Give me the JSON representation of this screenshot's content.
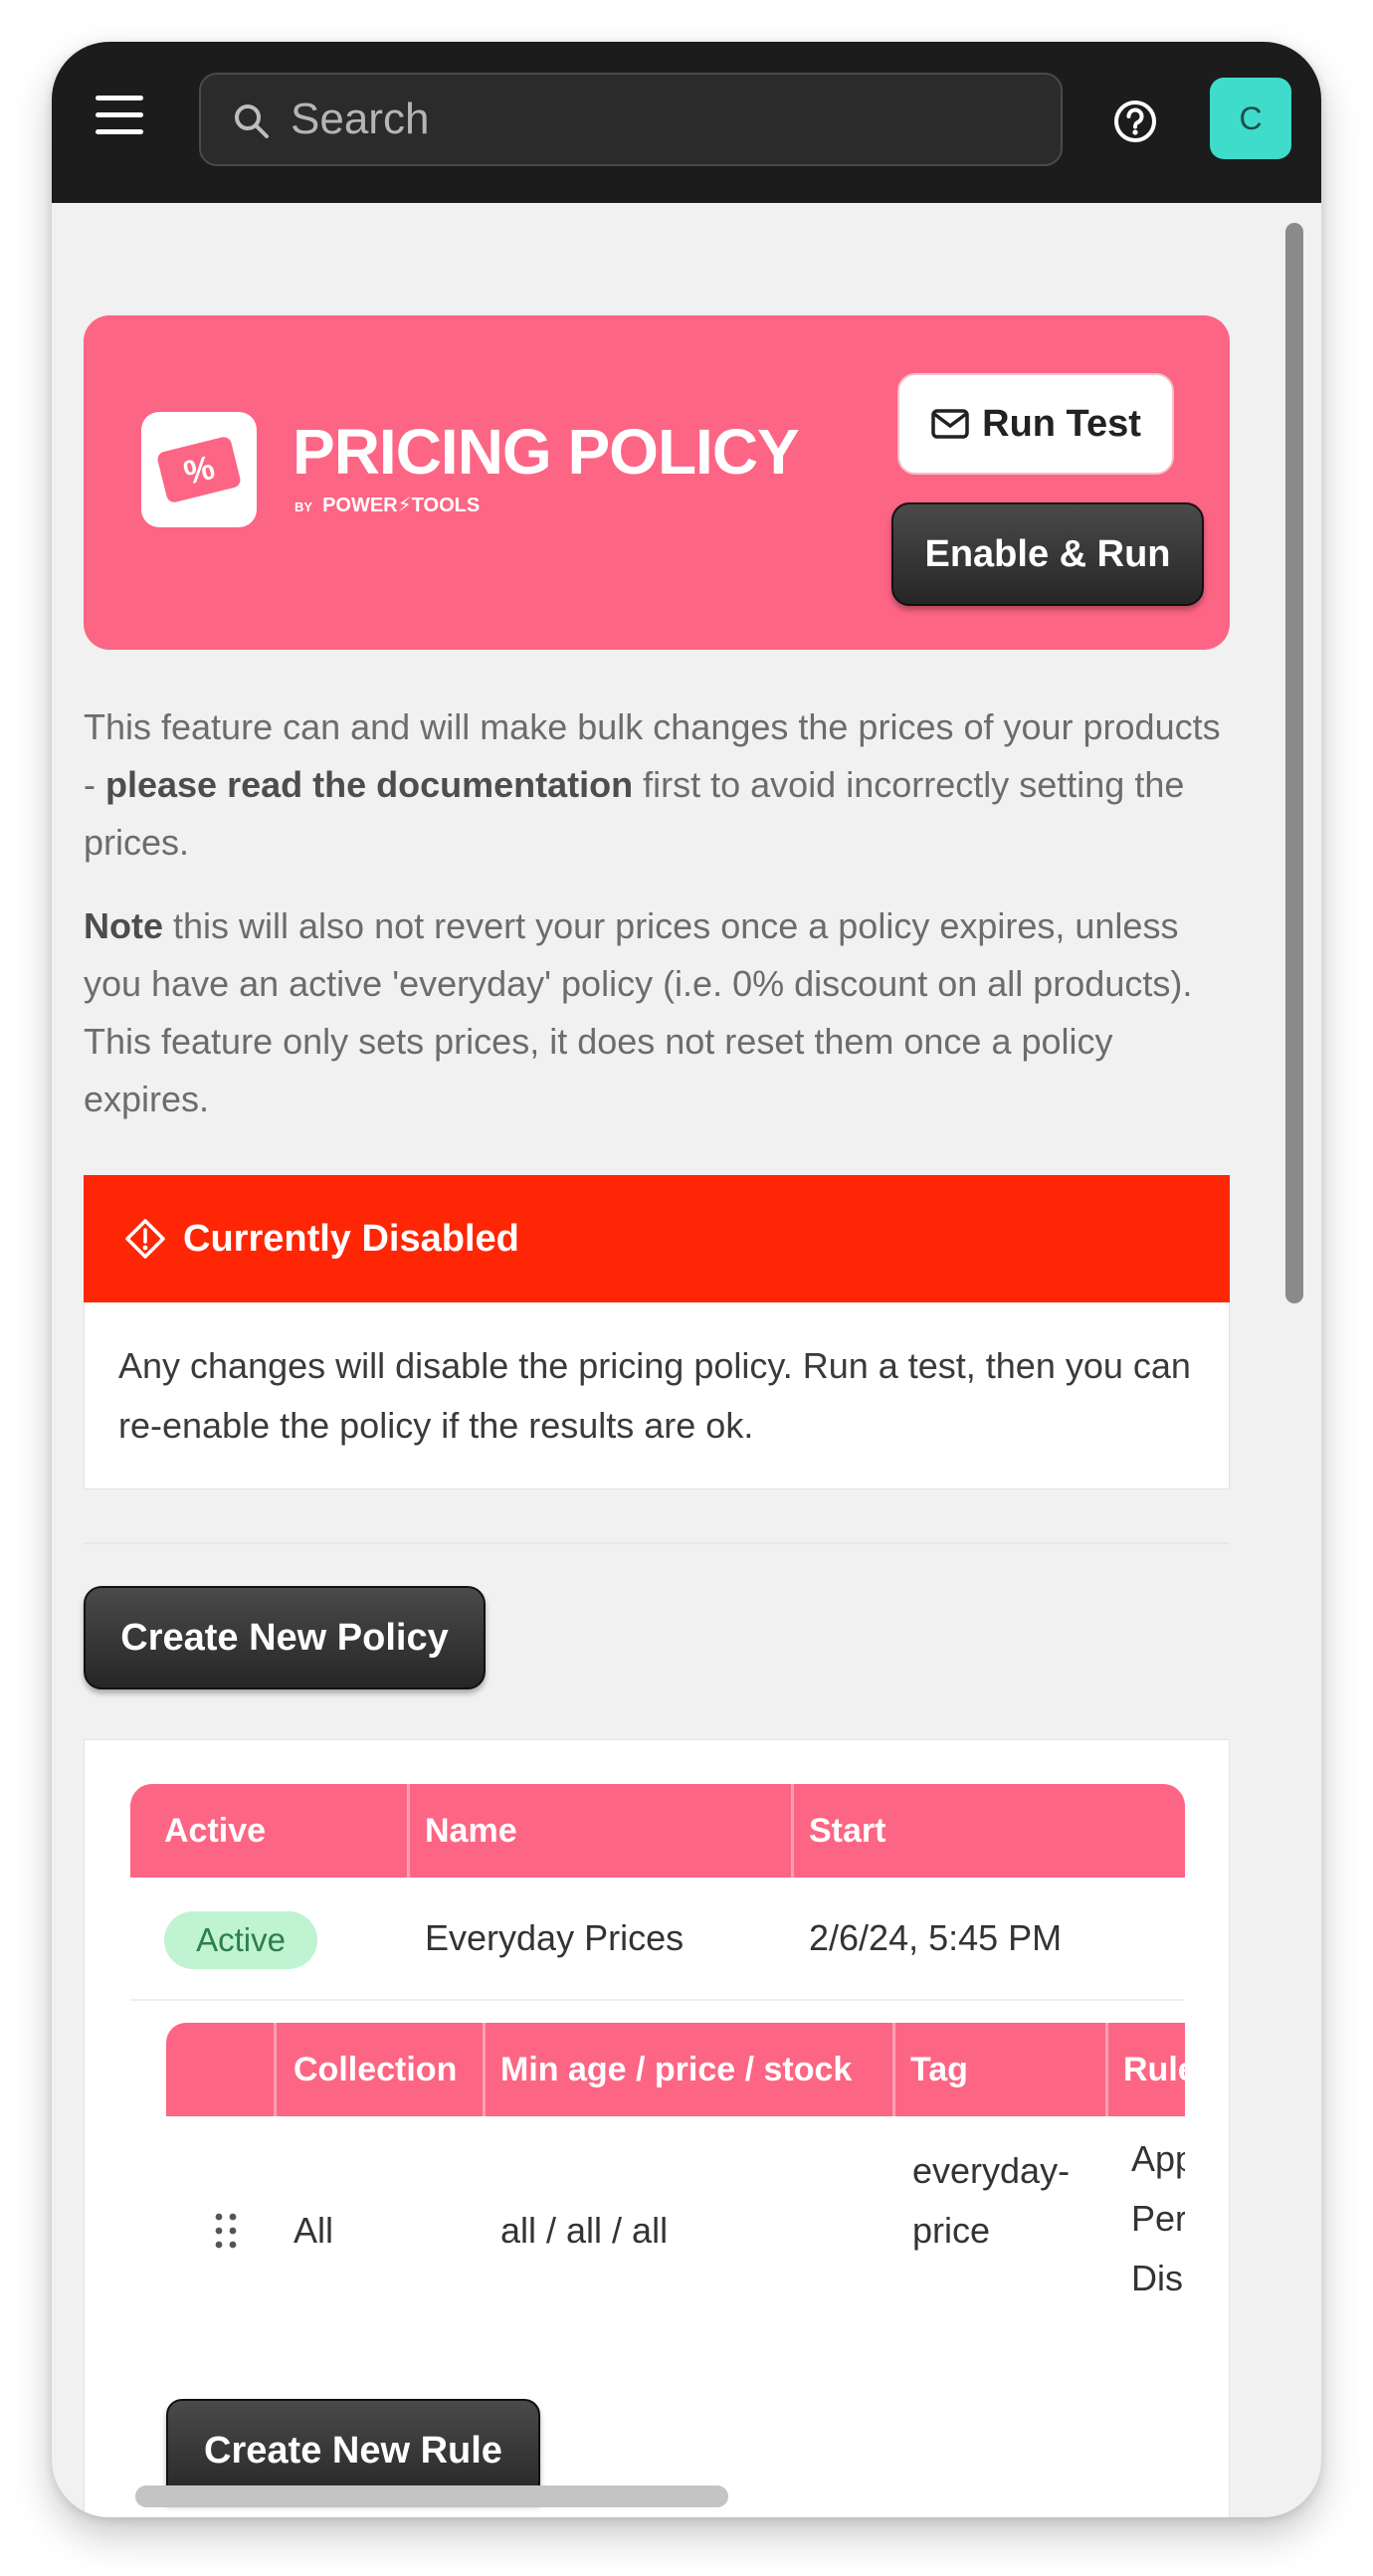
{
  "topbar": {
    "search_placeholder": "Search",
    "avatar_initial": "C",
    "icons": {
      "menu": "hamburger-menu-icon",
      "search": "search-icon",
      "help": "help-circle-icon"
    }
  },
  "banner": {
    "title": "PRICING POLICY",
    "subtitle_by": "BY",
    "subtitle_brand": "POWER⚡TOOLS",
    "logo_glyph": "%",
    "run_test_label": "Run Test",
    "enable_run_label": "Enable & Run",
    "color": "#fd6584"
  },
  "intro": {
    "p1_before": "This feature can and will make bulk changes the prices of your products - ",
    "p1_bold": "please read the documentation",
    "p1_after": " first to avoid incorrectly setting the prices.",
    "p2_bold": "Note",
    "p2_after": " this will also not revert your prices once a policy expires, unless you have an active 'everyday' policy (i.e. 0% discount on all products). This feature only sets prices, it does not reset them once a policy expires."
  },
  "alert": {
    "title": "Currently Disabled",
    "message": "Any changes will disable the pricing policy. Run a test, then you can re-enable the policy if the results are ok.",
    "color": "#fe2605"
  },
  "create_policy_label": "Create New Policy",
  "policies": {
    "columns": [
      "Active",
      "Name",
      "Start"
    ],
    "rows": [
      {
        "status": "Active",
        "name": "Everyday Prices",
        "start": "2/6/24, 5:45 PM"
      }
    ]
  },
  "rules": {
    "columns": [
      "Collection",
      "Min age / price / stock",
      "Tag",
      "Rule"
    ],
    "rows": [
      {
        "collection": "All",
        "min": "all / all / all",
        "tag_line1": "everyday-",
        "tag_line2": "price",
        "rule_line1": "App",
        "rule_line2": "Per",
        "rule_line3": "Dis"
      }
    ],
    "create_rule_label": "Create New Rule"
  }
}
